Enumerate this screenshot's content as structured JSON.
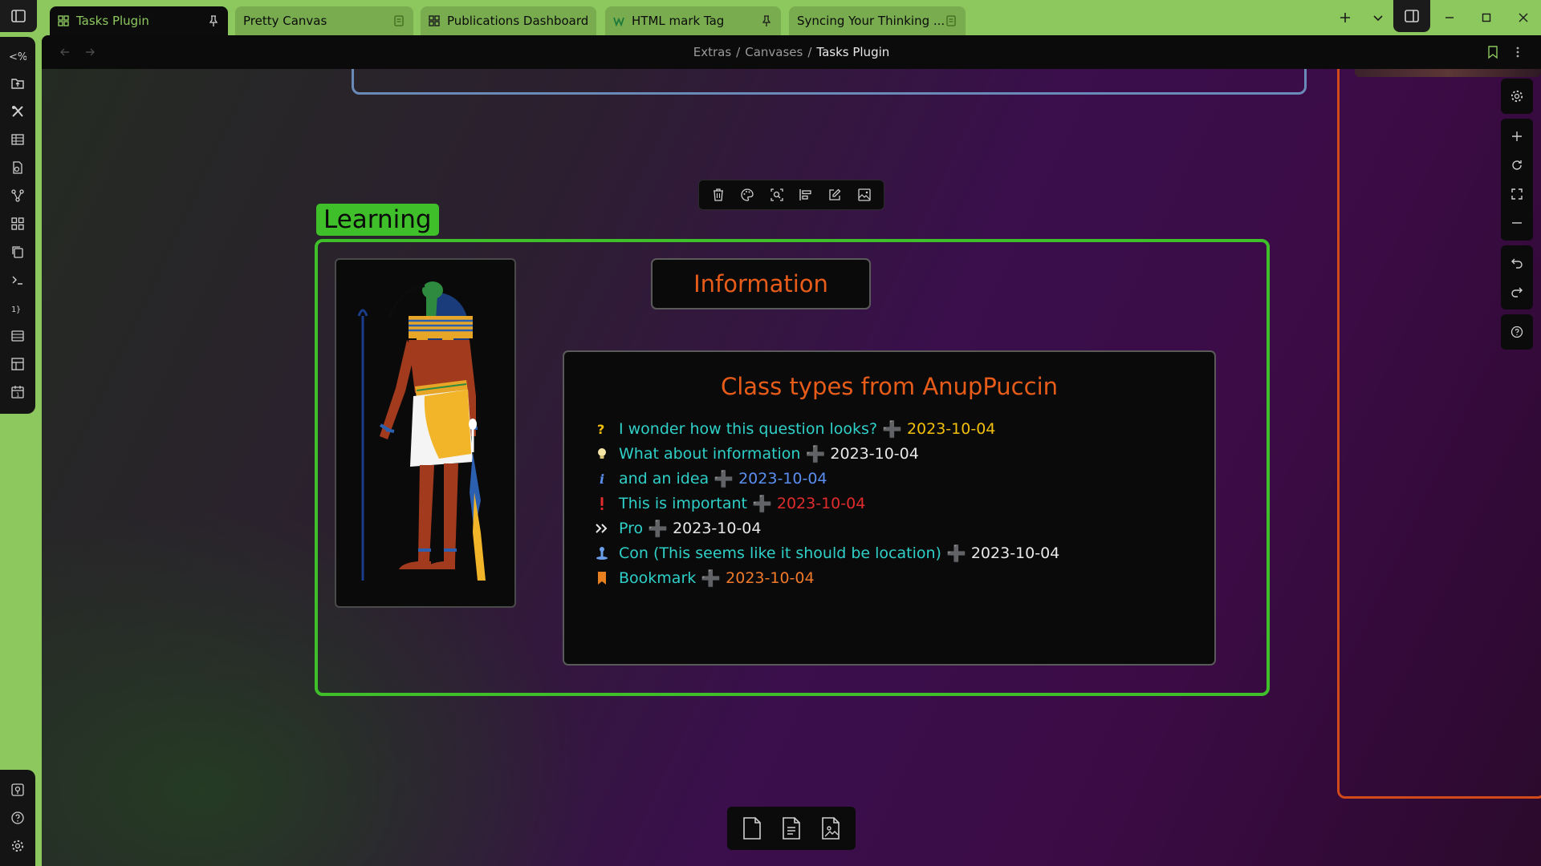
{
  "tabs": [
    {
      "title": "Tasks Plugin",
      "icon": "canvas-icon",
      "end_icon": "pin-icon",
      "active": true
    },
    {
      "title": "Pretty Canvas",
      "icon": "",
      "end_icon": "note-icon",
      "active": false
    },
    {
      "title": "Publications Dashboard",
      "icon": "canvas-icon",
      "end_icon": "",
      "active": false
    },
    {
      "title": "HTML mark Tag",
      "icon": "web-icon",
      "end_icon": "pin-icon",
      "active": false
    },
    {
      "title": "Syncing Your Thinking ...",
      "icon": "",
      "end_icon": "note-icon",
      "active": false
    }
  ],
  "breadcrumb": {
    "parts": [
      "Extras",
      "Canvases"
    ],
    "current": "Tasks Plugin",
    "separator": "/"
  },
  "ribbon": {
    "top_icons": [
      "templater-icon",
      "open-folder-icon",
      "tools-icon",
      "table-icon",
      "file-search-icon",
      "graph-icon",
      "grid-icon",
      "copy-icon",
      "terminal-icon",
      "hash-icon",
      "list-add-icon",
      "layout-icon",
      "calendar-icon"
    ],
    "bottom_icons": [
      "vault-icon",
      "help-icon",
      "settings-icon"
    ]
  },
  "canvas": {
    "group_label": "Learning",
    "info_title": "Information",
    "class_title": "Class types from AnupPuccin",
    "tasks": [
      {
        "text": "I wonder how this question looks?",
        "date": "2023-10-04",
        "icon": "question-icon",
        "icon_color": "#f2c00c",
        "date_color": "#f2c00c"
      },
      {
        "text": "What about information",
        "date": "2023-10-04",
        "icon": "lightbulb-icon",
        "icon_color": "#f5e6a8",
        "date_color": "#e8e8e8"
      },
      {
        "text": "and an idea",
        "date": "2023-10-04",
        "icon": "info-icon",
        "icon_color": "#5a8ff0",
        "date_color": "#5a8ff0"
      },
      {
        "text": "This is important",
        "date": "2023-10-04",
        "icon": "exclamation-icon",
        "icon_color": "#e02c2c",
        "date_color": "#e02c2c"
      },
      {
        "text": "Pro",
        "date": "2023-10-04",
        "icon": "double-chevron-icon",
        "icon_color": "#e8e8e8",
        "date_color": "#e8e8e8"
      },
      {
        "text": "Con (This seems like it should be location)",
        "date": "2023-10-04",
        "icon": "location-icon",
        "icon_color": "#6a9ee8",
        "date_color": "#e8e8e8"
      },
      {
        "text": "Bookmark",
        "date": "2023-10-04",
        "icon": "bookmark-icon",
        "icon_color": "#e88020",
        "date_color": "#f07a2a"
      }
    ],
    "plus_symbol": "➕"
  },
  "colors": {
    "app_accent": "#8dc85e",
    "group_green": "#3fbf2a",
    "orange_text": "#e85c1a",
    "task_text": "#2fd0c8"
  }
}
